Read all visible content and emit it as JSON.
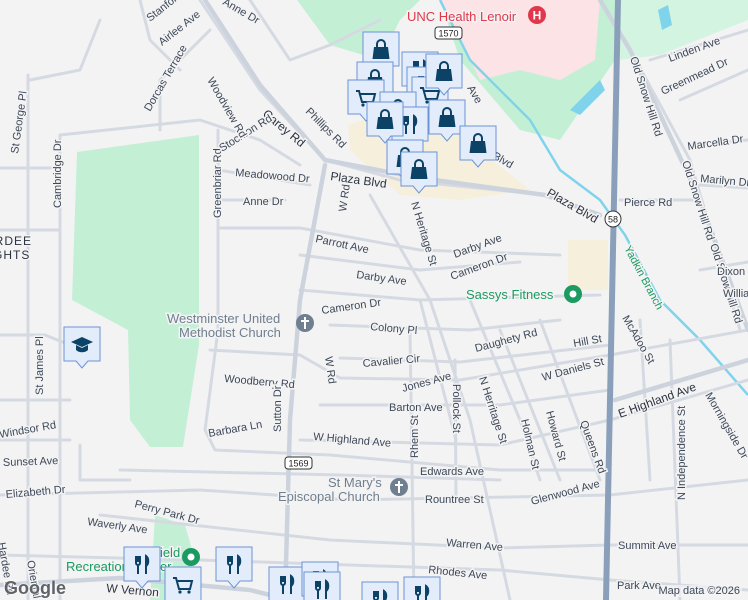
{
  "map": {
    "attribution": "Map data ©2026",
    "logo": "Google",
    "colors": {
      "park": "#c3f0d5",
      "hospital": "#fbe3e6",
      "shopping": "#f5efdc",
      "water": "#7fd4ec",
      "highway": "#8aa0ba",
      "marker_fill": "#e3ecfb",
      "marker_icon": "#0b4266",
      "poi_red": "#e0384a",
      "poi_green": "#1c9a62",
      "poi_gray": "#6f7f8f"
    },
    "shields": [
      "1570",
      "58",
      "1569"
    ],
    "pois": [
      {
        "name": "UNC Health Lenoir",
        "icon": "hospital-icon"
      },
      {
        "name": "Sassys Fitness",
        "icon": "fitness-icon"
      },
      {
        "name_line1": "Westminster United",
        "name_line2": "Methodist Church",
        "icon": "church-icon"
      },
      {
        "name_line1": "St Mary's",
        "name_line2": "Episcopal Church",
        "icon": "church-icon"
      },
      {
        "name_line1": "Field",
        "name_line2": "Recreation Center",
        "icon": "park-icon"
      }
    ],
    "neighborhood": {
      "line1": "HARDEE",
      "line2": "HEIGHTS"
    },
    "streets": [
      "Carey Rd",
      "Plaza Blvd",
      "Plaza Blvd",
      "Blvd",
      "Phillips Rd",
      "Meadowood Dr",
      "Anne Dr",
      "Parrott Ave",
      "Darby Ave",
      "Darby Ave",
      "Cameron Dr",
      "Cameron Dr",
      "Colony Pl",
      "Cavalier Cir",
      "Woodberry Rd",
      "Jones Ave",
      "Barton Ave",
      "W Highland Ave",
      "Edwards Ave",
      "Rountree St",
      "Glenwood Ave",
      "Warren Ave",
      "Rhodes Ave",
      "Summit Ave",
      "Park Ave",
      "Hill St",
      "W Daniels St",
      "Daughety Rd",
      "E Highland Ave",
      "McAdoo St",
      "N Independence St",
      "Morningside Dr",
      "Old Snow Hill Rd",
      "Old Snow Hill Rd",
      "Old Snow Hill Rd",
      "Linden Ave",
      "Greenmead Dr",
      "Marcella Dr",
      "Marilyn Dr",
      "Pierce Rd",
      "Dixon",
      "Willia",
      "N Heritage St",
      "N Herritage St",
      "Holman St",
      "Howard St",
      "Queens Rd",
      "Pollock St",
      "Rhem St",
      "W Rd",
      "W Rd",
      "Sutton Dr",
      "Barbara Ln",
      "Greenbriar Rd",
      "Stockton Rd",
      "Woodview Rd",
      "Dorcas Terrace",
      "Airlee Ave",
      "Cambridge Dr",
      "St George Pl",
      "St James Pl",
      "Windsor Rd",
      "Sunset Ave",
      "Elizabeth Dr",
      "Perry Park Dr",
      "Waverly Ave",
      "Oriental Ave",
      "Hardee Rd",
      "W Vernon",
      "Yadkin Branch",
      "Stanford",
      "Anne Dr",
      "Rd",
      "Ave"
    ],
    "markers": [
      "shopping-bag",
      "shopping-bag",
      "shopping-cart",
      "restaurant",
      "restaurant",
      "shopping-cart",
      "shopping-bag",
      "shopping-bag",
      "restaurant",
      "shopping-bag",
      "shopping-bag",
      "shopping-bag",
      "shopping-bag",
      "shopping-bag",
      "school",
      "restaurant",
      "shopping-cart",
      "restaurant",
      "restaurant",
      "restaurant",
      "restaurant",
      "restaurant",
      "restaurant"
    ]
  }
}
